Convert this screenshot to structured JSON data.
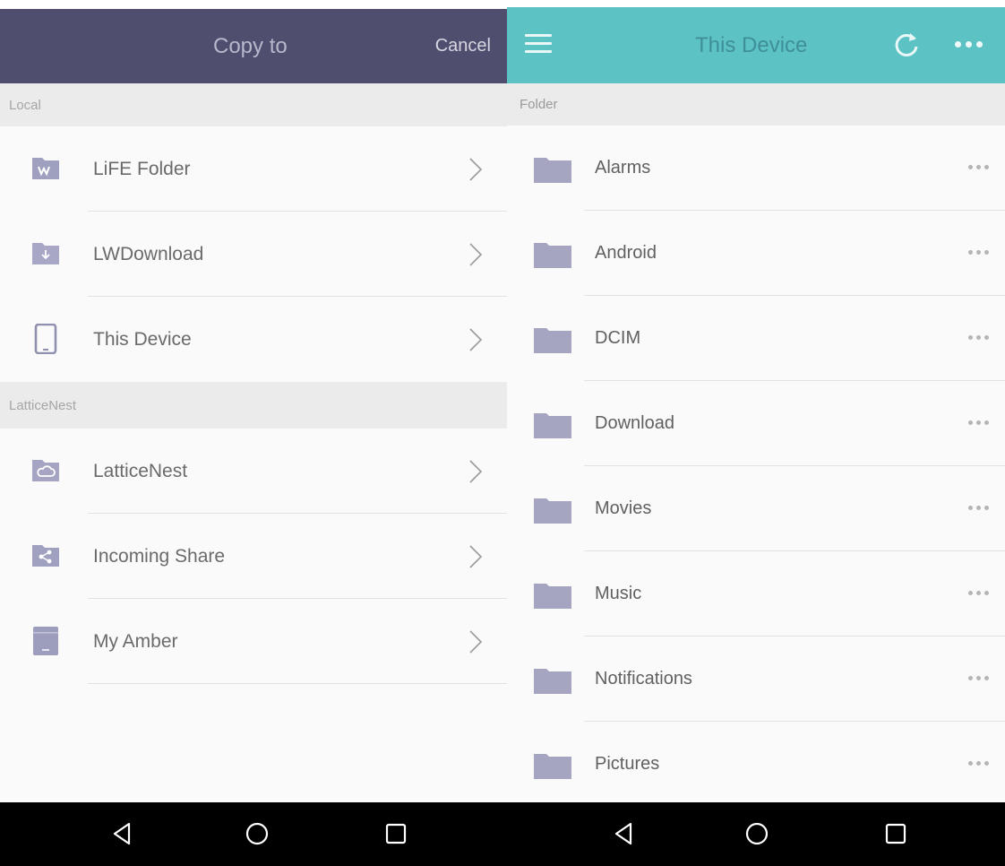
{
  "left": {
    "header": {
      "title": "Copy to",
      "cancel_label": "Cancel"
    },
    "sections": {
      "local": "Local",
      "latticenest": "LatticeNest"
    },
    "local_items": [
      {
        "label": "LiFE Folder",
        "icon": "life-folder-icon"
      },
      {
        "label": "LWDownload",
        "icon": "download-folder-icon"
      },
      {
        "label": "This Device",
        "icon": "tablet-icon"
      }
    ],
    "cloud_items": [
      {
        "label": "LatticeNest",
        "icon": "cloud-folder-icon"
      },
      {
        "label": "Incoming Share",
        "icon": "share-folder-icon"
      },
      {
        "label": "My Amber",
        "icon": "amber-device-icon"
      }
    ]
  },
  "right": {
    "header": {
      "title": "This Device"
    },
    "section": "Folder",
    "folders": [
      {
        "label": "Alarms"
      },
      {
        "label": "Android"
      },
      {
        "label": "DCIM"
      },
      {
        "label": "Download"
      },
      {
        "label": "Movies"
      },
      {
        "label": "Music"
      },
      {
        "label": "Notifications"
      },
      {
        "label": "Pictures"
      }
    ]
  },
  "colors": {
    "left_header": "#4f4e6e",
    "right_header": "#5cc2c4",
    "icon": "#9f9fc0",
    "folder": "#a5a5c2"
  }
}
